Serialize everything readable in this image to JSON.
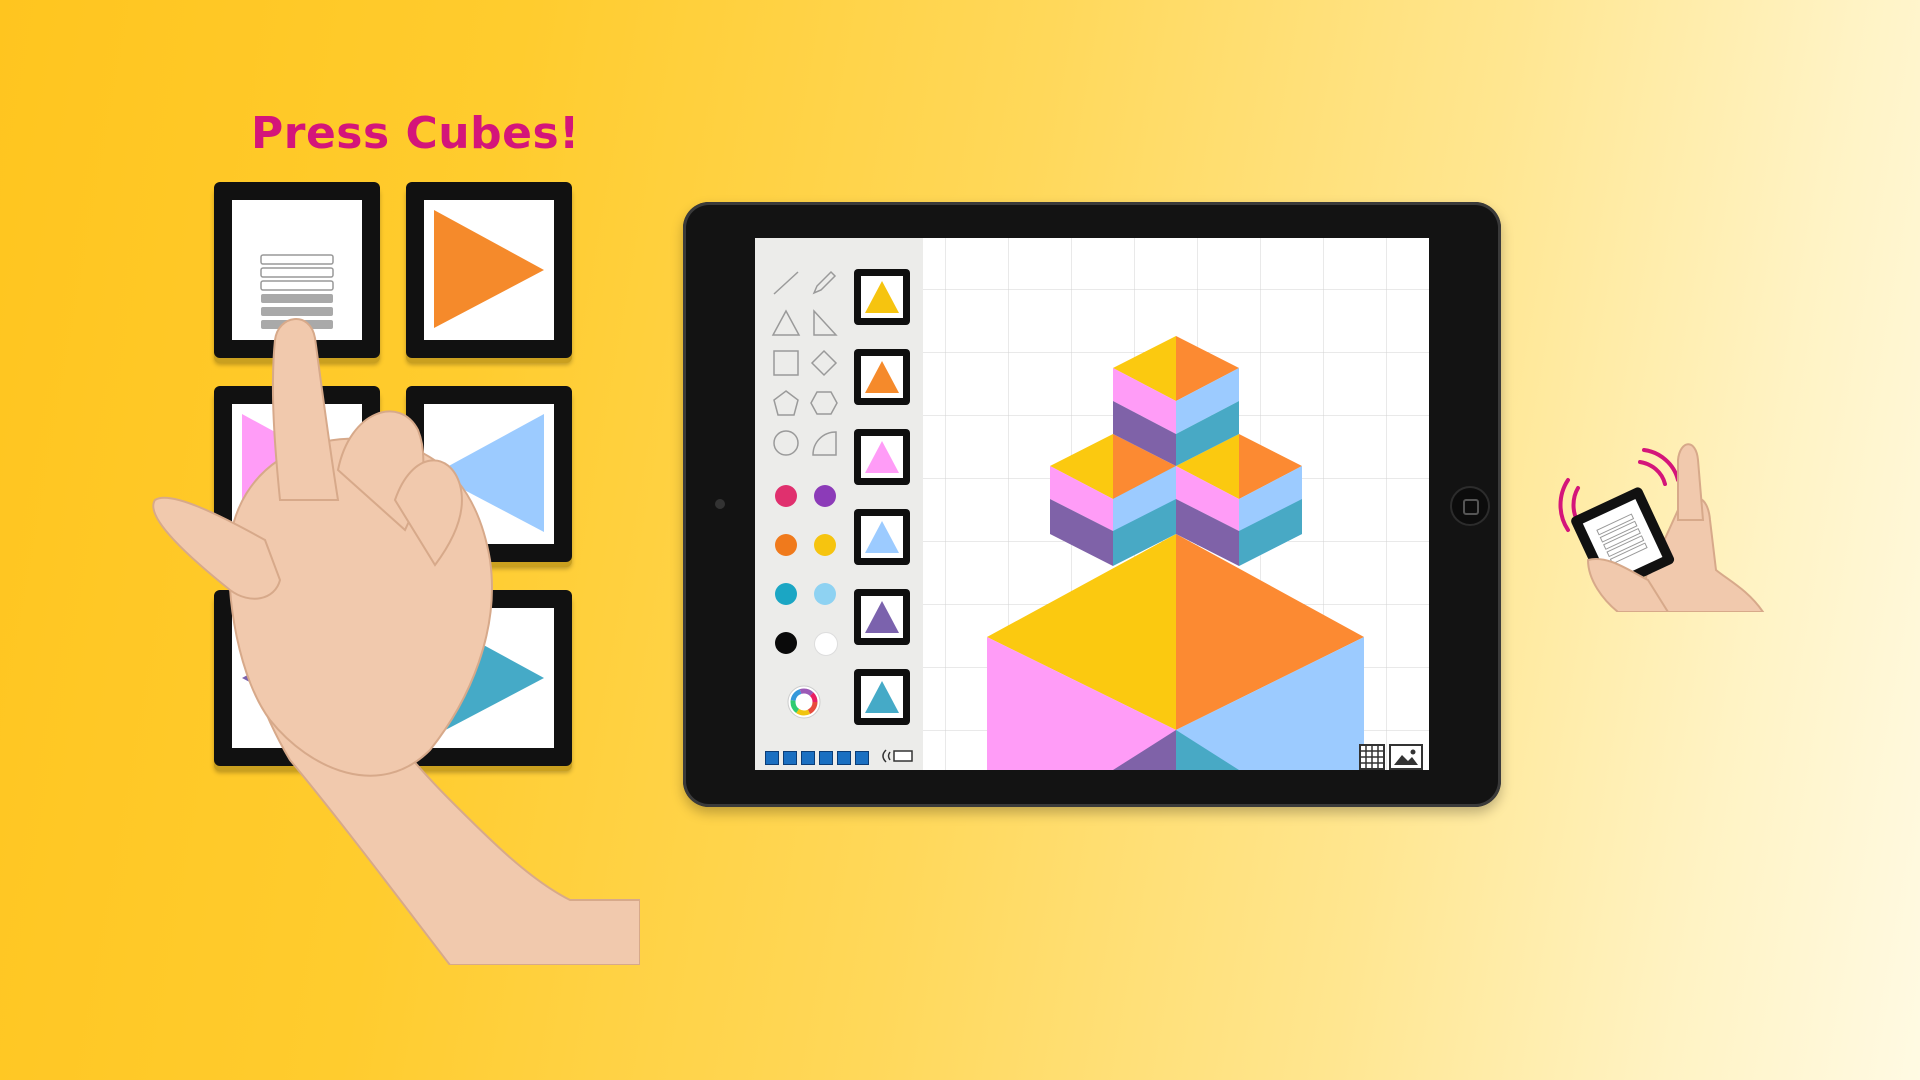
{
  "heading": "Press Cubes!",
  "cubes": [
    {
      "icon": "list-icon",
      "color": "#ffffff"
    },
    {
      "icon": "triangle-right-icon",
      "color": "#f58a2b"
    },
    {
      "icon": "triangle-right-icon",
      "color": "#ff9cf7"
    },
    {
      "icon": "triangle-left-icon",
      "color": "#9ccbff"
    },
    {
      "icon": "triangle-left-icon",
      "color": "#7b62ad"
    },
    {
      "icon": "triangle-right-icon",
      "color": "#45aac7"
    }
  ],
  "app": {
    "tools": [
      "line-icon",
      "pencil-icon",
      "triangle-icon",
      "right-triangle-icon",
      "square-icon",
      "diamond-icon",
      "pentagon-icon",
      "hexagon-icon",
      "circle-icon",
      "quarter-circle-icon"
    ],
    "palette": [
      "#e0306e",
      "#8c3bb8",
      "#f07a1c",
      "#f6c40f",
      "#1ba6c4",
      "#8ed2f2",
      "#0a0a0a",
      "#ffffff"
    ],
    "shape_buttons": [
      "#f6c40f",
      "#f58a2b",
      "#ff9cf7",
      "#9ccbff",
      "#7b62ad",
      "#45aac7"
    ],
    "page_count": 6,
    "colors": {
      "yellow": "#fbc910",
      "orange": "#fc8a32",
      "pink": "#ff9cf7",
      "light_blue": "#9ccbff",
      "purple": "#7f62a8",
      "teal": "#48a9c5"
    }
  },
  "phone": {
    "icon": "list-icon",
    "signal": "wireless-signal-icon"
  }
}
